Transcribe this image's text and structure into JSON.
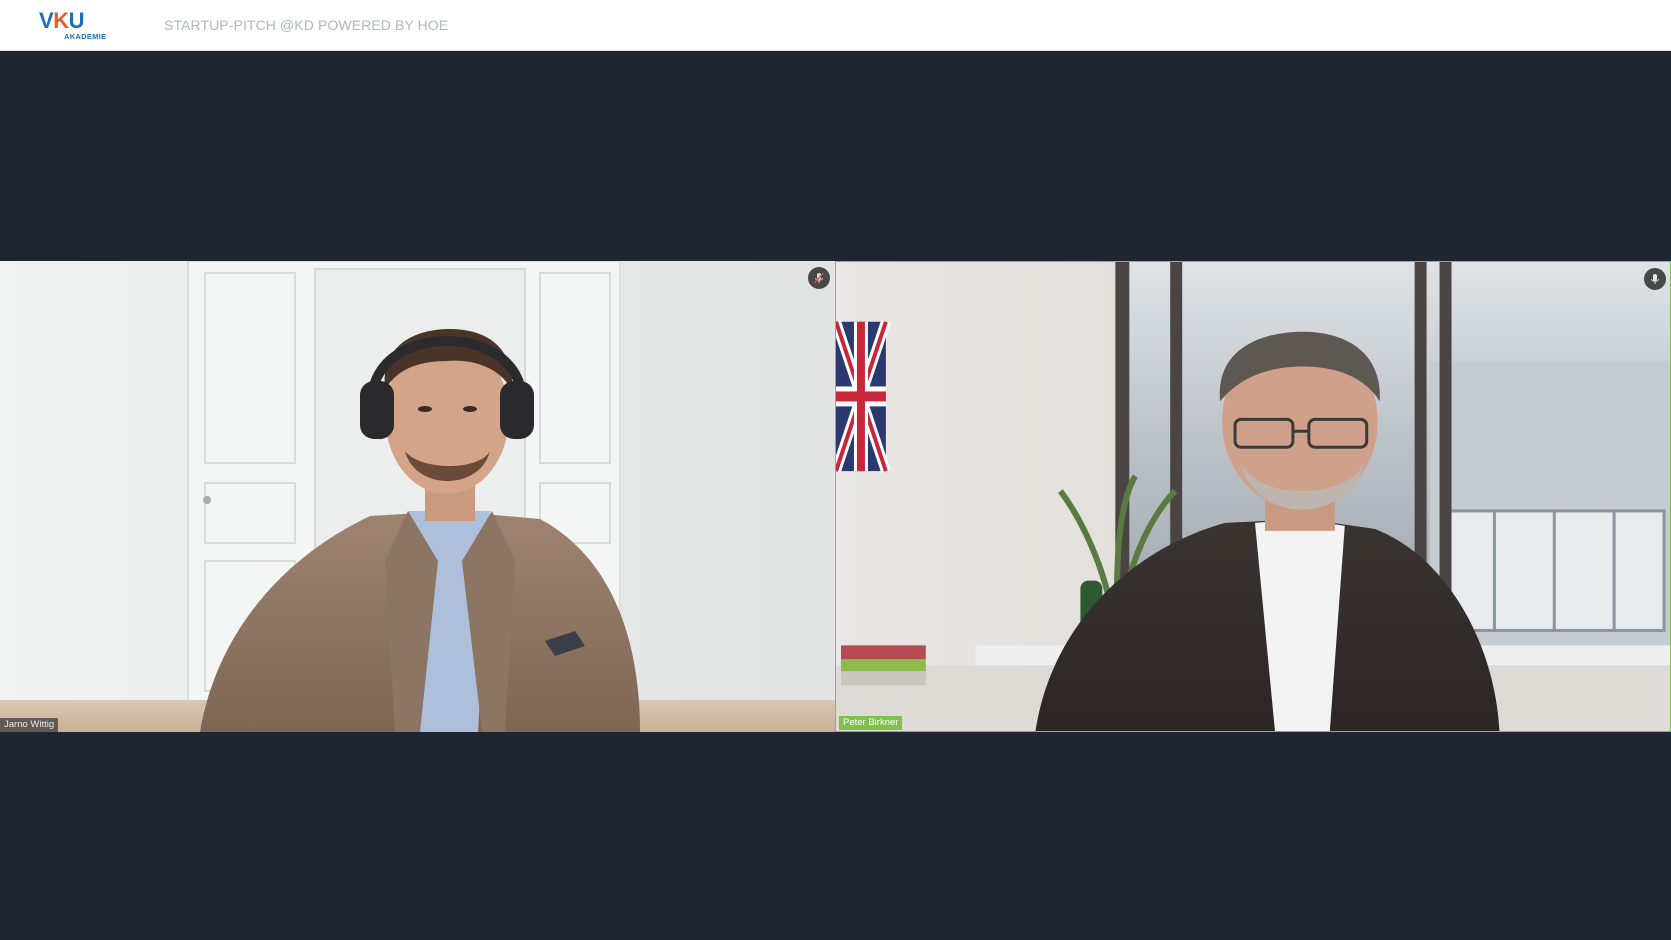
{
  "header": {
    "logo": {
      "main_v": "V",
      "main_k": "K",
      "main_u": "U",
      "sub": "AKADEMIE"
    },
    "event_title": "STARTUP-PITCH @KD POWERED BY HOE"
  },
  "participants": [
    {
      "name": "Jarno Wittig",
      "mic": "muted",
      "active_speaker": false
    },
    {
      "name": "Peter Birkner",
      "mic": "on",
      "active_speaker": true
    }
  ],
  "colors": {
    "stage_bg": "#1f2631",
    "active_speaker_border": "#7fc14a",
    "brand_blue": "#1f6fb6",
    "brand_orange": "#ea5b2a"
  }
}
